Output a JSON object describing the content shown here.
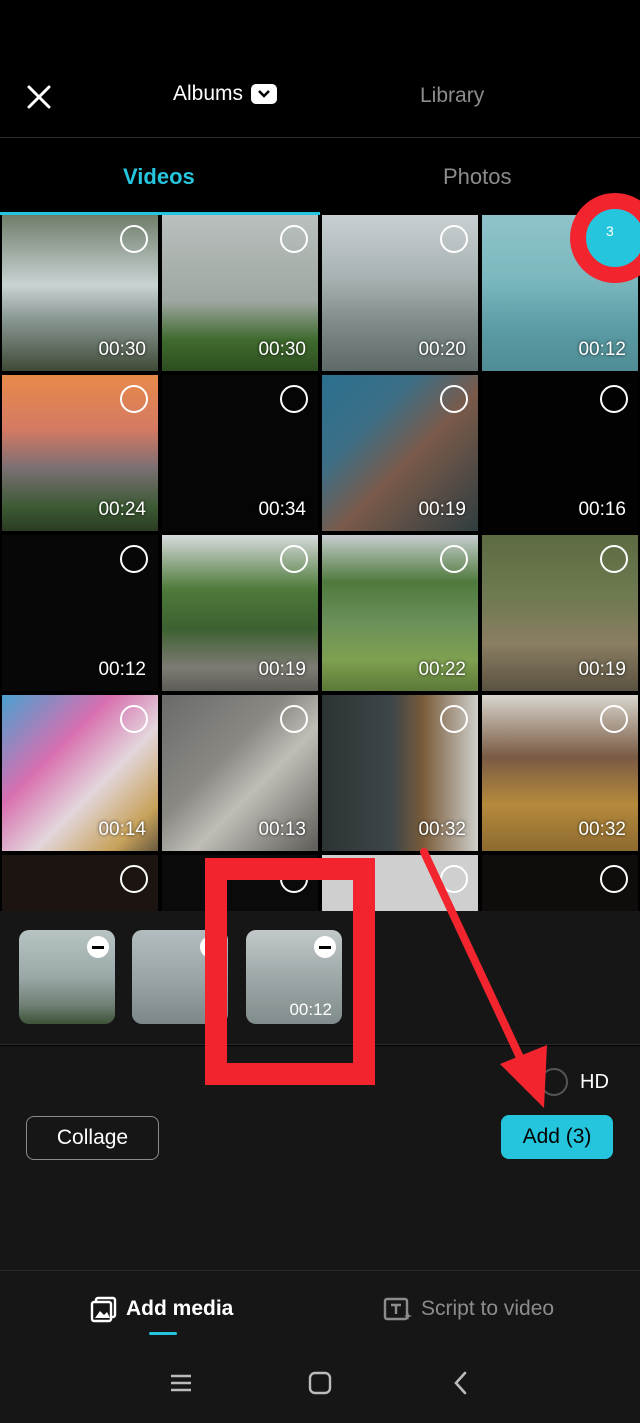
{
  "header": {
    "albums_label": "Albums",
    "library_label": "Library"
  },
  "tabs": {
    "videos": "Videos",
    "photos": "Photos"
  },
  "grid": [
    {
      "duration": "00:30"
    },
    {
      "duration": "00:30"
    },
    {
      "duration": "00:20"
    },
    {
      "duration": "00:12",
      "selected_index": "3"
    },
    {
      "duration": "00:24"
    },
    {
      "duration": "00:34"
    },
    {
      "duration": "00:19"
    },
    {
      "duration": "00:16"
    },
    {
      "duration": "00:12"
    },
    {
      "duration": "00:19"
    },
    {
      "duration": "00:22"
    },
    {
      "duration": "00:19"
    },
    {
      "duration": "00:14"
    },
    {
      "duration": "00:13"
    },
    {
      "duration": "00:32"
    },
    {
      "duration": "00:32"
    }
  ],
  "tray": {
    "third_duration": "00:12"
  },
  "panel": {
    "hd_label": "HD",
    "collage_label": "Collage",
    "add_label": "Add (3)"
  },
  "bottom": {
    "add_media": "Add media",
    "script_to_video": "Script to video"
  },
  "colors": {
    "accent": "#25c6dd",
    "annotation": "#f2252f"
  }
}
